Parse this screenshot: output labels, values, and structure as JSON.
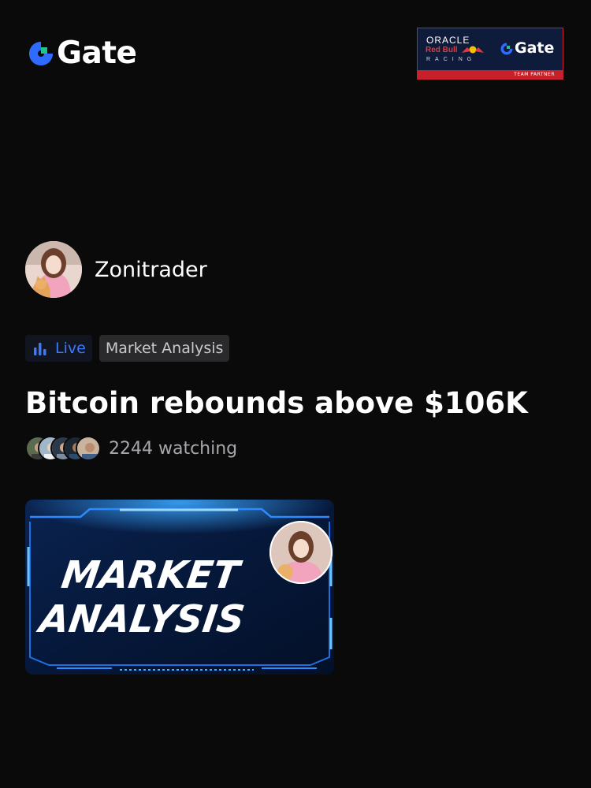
{
  "header": {
    "brand_name": "Gate",
    "partner_badge": {
      "oracle": "ORACLE",
      "red_bull": "Red Bull",
      "racing": "RACING",
      "brand": "Gate",
      "caption": "TEAM PARTNER"
    }
  },
  "stream": {
    "host_name": "Zonitrader",
    "live_label": "Live",
    "category": "Market Analysis",
    "title": "Bitcoin rebounds above $106K",
    "watching_label": "2244 watching",
    "thumbnail_text_line1": "MARKET",
    "thumbnail_text_line2": "ANALYSIS"
  },
  "colors": {
    "background": "#0a0a0b",
    "brand_blue": "#2f6bff",
    "brand_green": "#1ec489",
    "live_blue": "#3d79ff",
    "partner_navy": "#0f1b3a",
    "partner_red": "#c8202a"
  },
  "icons": {
    "brand": "gate-logo-icon",
    "live": "live-bars-icon"
  }
}
